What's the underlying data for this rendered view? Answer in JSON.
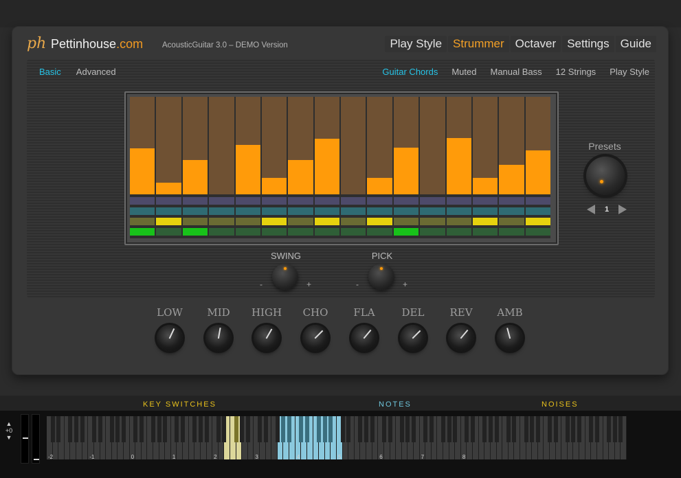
{
  "header": {
    "logo_mark": "ph",
    "logo_name": "Pettinhouse",
    "logo_domain": ".com",
    "subtitle": "AcousticGuitar 3.0 – DEMO Version",
    "tabs": [
      {
        "label": "Play Style",
        "active": false
      },
      {
        "label": "Strummer",
        "active": true
      },
      {
        "label": "Octaver",
        "active": false
      },
      {
        "label": "Settings",
        "active": false
      },
      {
        "label": "Guide",
        "active": false
      }
    ]
  },
  "subnav": {
    "left": [
      {
        "label": "Basic",
        "active": true
      },
      {
        "label": "Advanced",
        "active": false
      }
    ],
    "right": [
      {
        "label": "Guitar Chords",
        "active": true
      },
      {
        "label": "Muted",
        "active": false
      },
      {
        "label": "Manual Bass",
        "active": false
      },
      {
        "label": "12 Strings",
        "active": false
      },
      {
        "label": "Play Style",
        "active": false
      }
    ]
  },
  "sequencer": {
    "steps": 16,
    "velocities": [
      0.47,
      0.12,
      0.35,
      0.0,
      0.51,
      0.17,
      0.35,
      0.57,
      0.0,
      0.17,
      0.48,
      0.0,
      0.58,
      0.17,
      0.3,
      0.45
    ],
    "row_yellow": [
      false,
      true,
      false,
      false,
      false,
      true,
      false,
      true,
      false,
      true,
      false,
      false,
      false,
      true,
      false,
      true
    ],
    "row_green": [
      true,
      false,
      true,
      false,
      false,
      false,
      false,
      false,
      false,
      false,
      true,
      false,
      false,
      false,
      false,
      false
    ],
    "colors": {
      "bar": "#ff9b0a",
      "bar_bg": "#6f5133",
      "yellow": "#e6d20e",
      "green": "#18c21a"
    }
  },
  "presets": {
    "label": "Presets",
    "value": "1"
  },
  "swing": {
    "label": "SWING",
    "minus": "-",
    "plus": "+"
  },
  "pick": {
    "label": "PICK",
    "minus": "-",
    "plus": "+"
  },
  "fx_knobs": [
    {
      "label": "LOW",
      "angle": 25
    },
    {
      "label": "MID",
      "angle": 10
    },
    {
      "label": "HIGH",
      "angle": 30
    },
    {
      "label": "CHO",
      "angle": 45
    },
    {
      "label": "FLA",
      "angle": 40
    },
    {
      "label": "DEL",
      "angle": 45
    },
    {
      "label": "REV",
      "angle": 40
    },
    {
      "label": "AMB",
      "angle": -15
    }
  ],
  "keyboard": {
    "sections": [
      {
        "label": "KEY SWITCHES",
        "color": "#e8c11c"
      },
      {
        "label": "NOTES",
        "color": "#6fc6dc"
      },
      {
        "label": "NOISES",
        "color": "#e8c11c"
      }
    ],
    "octave_offset": "+0",
    "octave_labels": [
      "-2",
      "-1",
      "0",
      "1",
      "2",
      "3",
      "4",
      "5",
      "6",
      "7",
      "8"
    ]
  }
}
